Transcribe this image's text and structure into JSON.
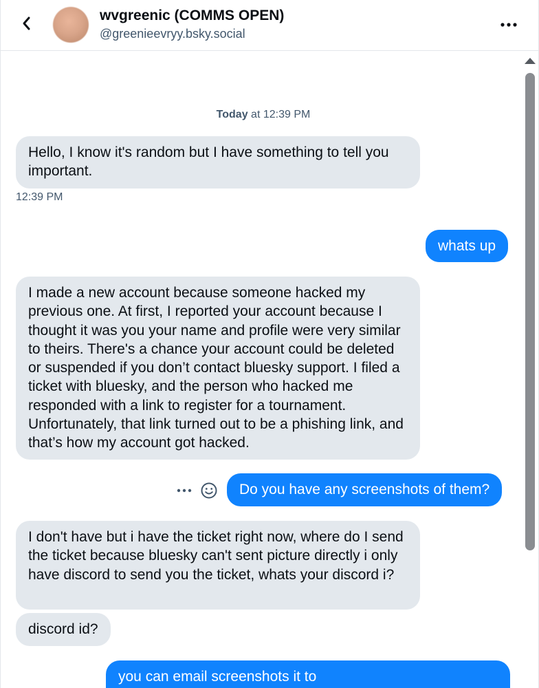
{
  "header": {
    "name": "wvgreenic (COMMS OPEN)",
    "handle": "@greenieevryy.bsky.social"
  },
  "conversation": {
    "date_day": "Today",
    "date_time": "at 12:39 PM",
    "first_message_time": "12:39 PM",
    "messages": [
      {
        "from": "them",
        "text": "Hello, I know it's random but I have something to tell you important."
      },
      {
        "from": "me",
        "text": "whats up"
      },
      {
        "from": "them",
        "text": "I made a new account because someone hacked my previous one. At first, I reported your account because I thought it was you your name and profile were very similar to theirs. There's a chance your account could be deleted or suspended if you don’t contact bluesky support. I filed a ticket with bluesky, and the person who hacked me responded with a link to register for a tournament. Unfortunately, that link turned out to be a phishing link, and that’s how my account got hacked."
      },
      {
        "from": "me",
        "text": "Do you have any screenshots of them?"
      },
      {
        "from": "them",
        "text": "I don't have but i have the ticket right now, where do I send the ticket because bluesky can't sent picture directly i only have discord to send you the ticket, whats your discord i?"
      },
      {
        "from": "them",
        "text": "discord id?"
      },
      {
        "from": "me",
        "text": "you can email screenshots it to"
      }
    ]
  },
  "colors": {
    "accent": "#1083fe",
    "incoming_bubble": "#e3e8ed",
    "muted_text": "#42576c"
  },
  "icons": {
    "back": "chevron-left-icon",
    "more": "ellipsis-horizontal-icon",
    "emoji": "smiley-icon"
  }
}
